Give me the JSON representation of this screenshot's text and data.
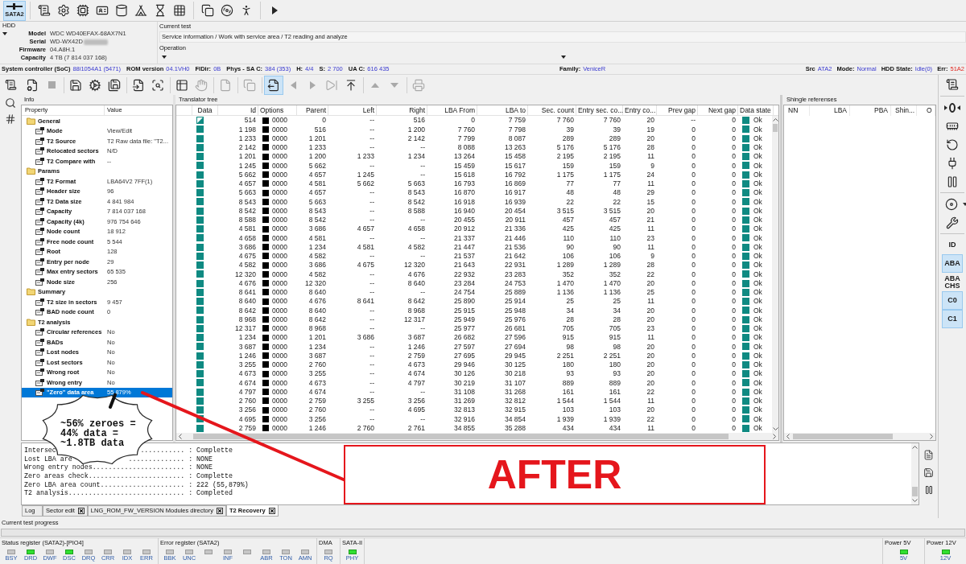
{
  "toolbar": {
    "items": [
      {
        "kind": "button",
        "label": "SATA2",
        "selected": true
      },
      {
        "kind": "separator"
      },
      {
        "kind": "button",
        "selected": false
      },
      {
        "kind": "button",
        "selected": false
      },
      {
        "kind": "button",
        "selected": false
      },
      {
        "kind": "button",
        "selected": false
      },
      {
        "kind": "button",
        "selected": false
      },
      {
        "kind": "button",
        "selected": false
      },
      {
        "kind": "button",
        "selected": false
      },
      {
        "kind": "button",
        "selected": false
      },
      {
        "kind": "separator"
      },
      {
        "kind": "button",
        "selected": false
      },
      {
        "kind": "button",
        "selected": false
      },
      {
        "kind": "button",
        "selected": false
      },
      {
        "kind": "separator"
      },
      {
        "kind": "button",
        "selected": false
      }
    ]
  },
  "hdd": {
    "title": "HDD",
    "fields": [
      {
        "label": "Model",
        "value": "WDC WD40EFAX-68AX7N1",
        "redacted": false
      },
      {
        "label": "Serial",
        "value": "WD-WX42D",
        "redacted": true
      },
      {
        "label": "Firmware",
        "value": "04.A8H.1",
        "redacted": false
      },
      {
        "label": "Capacity",
        "value": "4 TB (7 814 037 168)",
        "redacted": false
      }
    ]
  },
  "current_test": {
    "title": "Current test",
    "value": "Service information / Work with service area / T2 reading and analyze"
  },
  "operation": {
    "title": "Operation"
  },
  "status_line": {
    "left": [
      {
        "label": "System controller (SoC)",
        "value": "88i1054A1 (5471)",
        "alert": false
      },
      {
        "label": "ROM version",
        "value": "04.1VH0",
        "alert": false
      },
      {
        "label": "FIDir:",
        "value": "0B",
        "alert": false
      },
      {
        "label": "Phys - SA C:",
        "value": "384 (353)",
        "alert": false
      },
      {
        "label": "H:",
        "value": "4/4",
        "alert": false
      },
      {
        "label": "S:",
        "value": "2 700",
        "alert": false
      },
      {
        "label": "UA C:",
        "value": "616 435",
        "alert": false
      }
    ],
    "middle": [
      {
        "label": "Family:",
        "value": "VeniceR",
        "alert": false
      }
    ],
    "right": [
      {
        "label": "Src",
        "value": "ATA2",
        "alert": false
      },
      {
        "label": "Mode:",
        "value": "Normal",
        "alert": false
      },
      {
        "label": "HDD State:",
        "value": "Idle(0)",
        "alert": false
      },
      {
        "label": "Err:",
        "value": "51A2",
        "alert": true
      }
    ]
  },
  "toolbar2": {
    "items": [
      {
        "kind": "button",
        "disabled": false,
        "selected": false
      },
      {
        "kind": "button",
        "disabled": true,
        "selected": false
      },
      {
        "kind": "separator"
      },
      {
        "kind": "button",
        "disabled": false,
        "selected": false
      },
      {
        "kind": "button",
        "disabled": false,
        "selected": false
      },
      {
        "kind": "button",
        "disabled": false,
        "selected": false
      },
      {
        "kind": "separator"
      },
      {
        "kind": "button",
        "disabled": false,
        "selected": false
      },
      {
        "kind": "button",
        "disabled": false,
        "selected": false
      },
      {
        "kind": "separator"
      },
      {
        "kind": "button",
        "disabled": false,
        "selected": false
      },
      {
        "kind": "button",
        "disabled": true,
        "selected": false
      },
      {
        "kind": "separator"
      },
      {
        "kind": "button",
        "disabled": true,
        "selected": false
      },
      {
        "kind": "separator"
      },
      {
        "kind": "button",
        "disabled": true,
        "selected": false
      },
      {
        "kind": "separator"
      },
      {
        "kind": "button",
        "disabled": false,
        "selected": true
      },
      {
        "kind": "button",
        "disabled": true,
        "selected": false
      },
      {
        "kind": "button",
        "disabled": true,
        "selected": false
      },
      {
        "kind": "button",
        "disabled": true,
        "selected": false
      },
      {
        "kind": "button",
        "disabled": false,
        "selected": false
      },
      {
        "kind": "separator"
      },
      {
        "kind": "button",
        "disabled": true,
        "selected": false
      },
      {
        "kind": "button",
        "disabled": true,
        "selected": false
      },
      {
        "kind": "separator"
      },
      {
        "kind": "button",
        "disabled": true,
        "selected": false
      }
    ]
  },
  "right_toolbar": {
    "items": [
      {
        "kind": "button",
        "selected": false
      },
      {
        "kind": "separator"
      },
      {
        "kind": "button",
        "selected": false
      },
      {
        "kind": "button",
        "selected": false
      },
      {
        "kind": "button",
        "selected": false
      },
      {
        "kind": "button",
        "selected": false
      },
      {
        "kind": "button",
        "selected": false
      },
      {
        "kind": "separator"
      },
      {
        "kind": "dropdown",
        "selected": false
      },
      {
        "kind": "button",
        "selected": false
      },
      {
        "kind": "separator"
      },
      {
        "kind": "text",
        "label": "ID",
        "selected": false
      },
      {
        "kind": "text",
        "label": "ABA",
        "selected": true
      },
      {
        "kind": "text",
        "label": "ABA CHS",
        "selected": false
      },
      {
        "kind": "text",
        "label": "C0",
        "selected": true
      },
      {
        "kind": "text",
        "label": "C1",
        "selected": true
      }
    ]
  },
  "info": {
    "title": "Info",
    "columns": [
      "Property",
      "Value"
    ],
    "groups": [
      {
        "label": "General",
        "selected": false,
        "children": [
          {
            "label": "Mode",
            "value": "View/Edit",
            "selected": false
          },
          {
            "label": "T2 Source",
            "value": "T2 Raw data file: \"T2...",
            "selected": false
          },
          {
            "label": "Relocated sectors",
            "value": "N/D",
            "selected": false
          },
          {
            "label": "T2 Compare with",
            "value": "--",
            "selected": false
          }
        ]
      },
      {
        "label": "Params",
        "selected": false,
        "children": [
          {
            "label": "T2 Format",
            "value": "LBA64V2 7FF(1)",
            "selected": false
          },
          {
            "label": "Header size",
            "value": "96",
            "selected": false
          },
          {
            "label": "T2 Data size",
            "value": "4 841 984",
            "selected": false
          },
          {
            "label": "Capacity",
            "value": "7 814 037 168",
            "selected": false
          },
          {
            "label": "Capacity (4k)",
            "value": "976 754 646",
            "selected": false
          },
          {
            "label": "Node count",
            "value": "18 912",
            "selected": false
          },
          {
            "label": "Free node count",
            "value": "5 544",
            "selected": false
          },
          {
            "label": "Root",
            "value": "128",
            "selected": false
          },
          {
            "label": "Entry per node",
            "value": "29",
            "selected": false
          },
          {
            "label": "Max entry sectors",
            "value": "65 535",
            "selected": false
          },
          {
            "label": "Node size",
            "value": "256",
            "selected": false
          }
        ]
      },
      {
        "label": "Summary",
        "selected": false,
        "children": [
          {
            "label": "T2 size in sectors",
            "value": "9 457",
            "selected": false
          },
          {
            "label": "BAD node count",
            "value": "0",
            "selected": false
          }
        ]
      },
      {
        "label": "T2 analysis",
        "selected": false,
        "children": [
          {
            "label": "Circular references",
            "value": "No",
            "selected": false
          },
          {
            "label": "BADs",
            "value": "No",
            "selected": false
          },
          {
            "label": "Lost nodes",
            "value": "No",
            "selected": false
          },
          {
            "label": "Lost sectors",
            "value": "No",
            "selected": false
          },
          {
            "label": "Wrong root",
            "value": "No",
            "selected": false
          },
          {
            "label": "Wrong entry",
            "value": "No",
            "selected": false
          },
          {
            "label": "\"Zero\" data area",
            "value": "55,879%",
            "selected": true
          }
        ]
      }
    ]
  },
  "translator": {
    "title": "Translator tree",
    "columns": [
      "Data",
      "Id",
      "Options",
      "Parent",
      "Left",
      "Right",
      "LBA From",
      "LBA to",
      "Sec. count",
      "Entry sec. co...",
      "Entry co...",
      "Prev gap",
      "Next gap",
      "Data state"
    ],
    "rows": [
      {
        "partial": true,
        "cells": [
          "",
          "514",
          "0000",
          "0",
          "--",
          "516",
          "0",
          "7 759",
          "7 760",
          "7 760",
          "20",
          "--",
          "0",
          "Ok"
        ]
      },
      {
        "partial": false,
        "cells": [
          "",
          "1 198",
          "0000",
          "516",
          "--",
          "1 200",
          "7 760",
          "7 798",
          "39",
          "39",
          "19",
          "0",
          "0",
          "Ok"
        ]
      },
      {
        "partial": false,
        "cells": [
          "",
          "1 233",
          "0000",
          "1 201",
          "--",
          "2 142",
          "7 799",
          "8 087",
          "289",
          "289",
          "20",
          "0",
          "0",
          "Ok"
        ]
      },
      {
        "partial": false,
        "cells": [
          "",
          "2 142",
          "0000",
          "1 233",
          "--",
          "--",
          "8 088",
          "13 263",
          "5 176",
          "5 176",
          "28",
          "0",
          "0",
          "Ok"
        ]
      },
      {
        "partial": false,
        "cells": [
          "",
          "1 201",
          "0000",
          "1 200",
          "1 233",
          "1 234",
          "13 264",
          "15 458",
          "2 195",
          "2 195",
          "11",
          "0",
          "0",
          "Ok"
        ]
      },
      {
        "partial": false,
        "cells": [
          "",
          "1 245",
          "0000",
          "5 662",
          "--",
          "--",
          "15 459",
          "15 617",
          "159",
          "159",
          "9",
          "0",
          "0",
          "Ok"
        ]
      },
      {
        "partial": false,
        "cells": [
          "",
          "5 662",
          "0000",
          "4 657",
          "1 245",
          "--",
          "15 618",
          "16 792",
          "1 175",
          "1 175",
          "24",
          "0",
          "0",
          "Ok"
        ]
      },
      {
        "partial": false,
        "cells": [
          "",
          "4 657",
          "0000",
          "4 581",
          "5 662",
          "5 663",
          "16 793",
          "16 869",
          "77",
          "77",
          "11",
          "0",
          "0",
          "Ok"
        ]
      },
      {
        "partial": false,
        "cells": [
          "",
          "5 663",
          "0000",
          "4 657",
          "--",
          "8 543",
          "16 870",
          "16 917",
          "48",
          "48",
          "29",
          "0",
          "0",
          "Ok"
        ]
      },
      {
        "partial": false,
        "cells": [
          "",
          "8 543",
          "0000",
          "5 663",
          "--",
          "8 542",
          "16 918",
          "16 939",
          "22",
          "22",
          "15",
          "0",
          "0",
          "Ok"
        ]
      },
      {
        "partial": false,
        "cells": [
          "",
          "8 542",
          "0000",
          "8 543",
          "--",
          "8 588",
          "16 940",
          "20 454",
          "3 515",
          "3 515",
          "20",
          "0",
          "0",
          "Ok"
        ]
      },
      {
        "partial": false,
        "cells": [
          "",
          "8 588",
          "0000",
          "8 542",
          "--",
          "--",
          "20 455",
          "20 911",
          "457",
          "457",
          "21",
          "0",
          "0",
          "Ok"
        ]
      },
      {
        "partial": false,
        "cells": [
          "",
          "4 581",
          "0000",
          "3 686",
          "4 657",
          "4 658",
          "20 912",
          "21 336",
          "425",
          "425",
          "11",
          "0",
          "0",
          "Ok"
        ]
      },
      {
        "partial": false,
        "cells": [
          "",
          "4 658",
          "0000",
          "4 581",
          "--",
          "--",
          "21 337",
          "21 446",
          "110",
          "110",
          "23",
          "0",
          "0",
          "Ok"
        ]
      },
      {
        "partial": false,
        "cells": [
          "",
          "3 686",
          "0000",
          "1 234",
          "4 581",
          "4 582",
          "21 447",
          "21 536",
          "90",
          "90",
          "11",
          "0",
          "0",
          "Ok"
        ]
      },
      {
        "partial": false,
        "cells": [
          "",
          "4 675",
          "0000",
          "4 582",
          "--",
          "--",
          "21 537",
          "21 642",
          "106",
          "106",
          "9",
          "0",
          "0",
          "Ok"
        ]
      },
      {
        "partial": false,
        "cells": [
          "",
          "4 582",
          "0000",
          "3 686",
          "4 675",
          "12 320",
          "21 643",
          "22 931",
          "1 289",
          "1 289",
          "28",
          "0",
          "0",
          "Ok"
        ]
      },
      {
        "partial": false,
        "cells": [
          "",
          "12 320",
          "0000",
          "4 582",
          "--",
          "4 676",
          "22 932",
          "23 283",
          "352",
          "352",
          "22",
          "0",
          "0",
          "Ok"
        ]
      },
      {
        "partial": false,
        "cells": [
          "",
          "4 676",
          "0000",
          "12 320",
          "--",
          "8 640",
          "23 284",
          "24 753",
          "1 470",
          "1 470",
          "20",
          "0",
          "0",
          "Ok"
        ]
      },
      {
        "partial": false,
        "cells": [
          "",
          "8 641",
          "0000",
          "8 640",
          "--",
          "--",
          "24 754",
          "25 889",
          "1 136",
          "1 136",
          "25",
          "0",
          "0",
          "Ok"
        ]
      },
      {
        "partial": false,
        "cells": [
          "",
          "8 640",
          "0000",
          "4 676",
          "8 641",
          "8 642",
          "25 890",
          "25 914",
          "25",
          "25",
          "11",
          "0",
          "0",
          "Ok"
        ]
      },
      {
        "partial": false,
        "cells": [
          "",
          "8 642",
          "0000",
          "8 640",
          "--",
          "8 968",
          "25 915",
          "25 948",
          "34",
          "34",
          "20",
          "0",
          "0",
          "Ok"
        ]
      },
      {
        "partial": false,
        "cells": [
          "",
          "8 968",
          "0000",
          "8 642",
          "--",
          "12 317",
          "25 949",
          "25 976",
          "28",
          "28",
          "20",
          "0",
          "0",
          "Ok"
        ]
      },
      {
        "partial": false,
        "cells": [
          "",
          "12 317",
          "0000",
          "8 968",
          "--",
          "--",
          "25 977",
          "26 681",
          "705",
          "705",
          "23",
          "0",
          "0",
          "Ok"
        ]
      },
      {
        "partial": false,
        "cells": [
          "",
          "1 234",
          "0000",
          "1 201",
          "3 686",
          "3 687",
          "26 682",
          "27 596",
          "915",
          "915",
          "11",
          "0",
          "0",
          "Ok"
        ]
      },
      {
        "partial": false,
        "cells": [
          "",
          "3 687",
          "0000",
          "1 234",
          "--",
          "1 246",
          "27 597",
          "27 694",
          "98",
          "98",
          "20",
          "0",
          "0",
          "Ok"
        ]
      },
      {
        "partial": false,
        "cells": [
          "",
          "1 246",
          "0000",
          "3 687",
          "--",
          "2 759",
          "27 695",
          "29 945",
          "2 251",
          "2 251",
          "20",
          "0",
          "0",
          "Ok"
        ]
      },
      {
        "partial": false,
        "cells": [
          "",
          "3 255",
          "0000",
          "2 760",
          "--",
          "4 673",
          "29 946",
          "30 125",
          "180",
          "180",
          "20",
          "0",
          "0",
          "Ok"
        ]
      },
      {
        "partial": false,
        "cells": [
          "",
          "4 673",
          "0000",
          "3 255",
          "--",
          "4 674",
          "30 126",
          "30 218",
          "93",
          "93",
          "20",
          "0",
          "0",
          "Ok"
        ]
      },
      {
        "partial": false,
        "cells": [
          "",
          "4 674",
          "0000",
          "4 673",
          "--",
          "4 797",
          "30 219",
          "31 107",
          "889",
          "889",
          "20",
          "0",
          "0",
          "Ok"
        ]
      },
      {
        "partial": false,
        "cells": [
          "",
          "4 797",
          "0000",
          "4 674",
          "--",
          "--",
          "31 108",
          "31 268",
          "161",
          "161",
          "22",
          "0",
          "0",
          "Ok"
        ]
      },
      {
        "partial": false,
        "cells": [
          "",
          "2 760",
          "0000",
          "2 759",
          "3 255",
          "3 256",
          "31 269",
          "32 812",
          "1 544",
          "1 544",
          "11",
          "0",
          "0",
          "Ok"
        ]
      },
      {
        "partial": false,
        "cells": [
          "",
          "3 256",
          "0000",
          "2 760",
          "--",
          "4 695",
          "32 813",
          "32 915",
          "103",
          "103",
          "20",
          "0",
          "0",
          "Ok"
        ]
      },
      {
        "partial": false,
        "cells": [
          "",
          "4 695",
          "0000",
          "3 256",
          "--",
          "--",
          "32 916",
          "34 854",
          "1 939",
          "1 939",
          "22",
          "0",
          "0",
          "Ok"
        ]
      },
      {
        "partial": false,
        "cells": [
          "",
          "2 759",
          "0000",
          "1 246",
          "2 760",
          "2 761",
          "34 855",
          "35 288",
          "434",
          "434",
          "11",
          "0",
          "0",
          "Ok"
        ]
      }
    ]
  },
  "shingle": {
    "title": "Shingle referenses",
    "columns": [
      "NN",
      "LBA",
      "PBA",
      "Shin...",
      "O"
    ]
  },
  "log": {
    "lines": [
      {
        "parts": [
          "Intersec",
          "..........."
        ],
        "value": ": Complette"
      },
      {
        "parts": [
          "Lost LBA are",
          ".............."
        ],
        "value": ": NONE"
      },
      {
        "parts": [
          "Wrong entry nodes......................."
        ],
        "value": ": NONE"
      },
      {
        "parts": [
          "Zero areas check........................"
        ],
        "value": ": Complette"
      },
      {
        "parts": [
          "Zero LBA area count....................."
        ],
        "value": ": 222 (55,879%)"
      },
      {
        "parts": [
          "T2 analysis............................."
        ],
        "value": ": Completed"
      }
    ]
  },
  "tabs": [
    {
      "label": "Log",
      "closable": false,
      "selected": false
    },
    {
      "label": "Sector edit",
      "closable": true,
      "selected": false
    },
    {
      "label": "LNG_ROM_FW_VERSION Modules directory",
      "closable": true,
      "selected": false
    },
    {
      "label": "T2 Recovery",
      "closable": true,
      "selected": true
    }
  ],
  "progress": {
    "label": "Current test progress"
  },
  "registers": [
    {
      "title": "Status register (SATA2)-[PIO4]",
      "leds": [
        {
          "label": "BSY",
          "on": false
        },
        {
          "label": "DRD",
          "on": true
        },
        {
          "label": "DWF",
          "on": false
        },
        {
          "label": "DSC",
          "on": true
        },
        {
          "label": "DRQ",
          "on": false
        },
        {
          "label": "CRR",
          "on": false
        },
        {
          "label": "IDX",
          "on": false
        },
        {
          "label": "ERR",
          "on": false
        }
      ]
    },
    {
      "title": "Error register (SATA2)",
      "leds": [
        {
          "label": "BBK",
          "on": false
        },
        {
          "label": "UNC",
          "on": false
        },
        {
          "on": false
        },
        {
          "label": "INF",
          "on": false
        },
        {
          "on": false
        },
        {
          "label": "ABR",
          "on": false
        },
        {
          "label": "TON",
          "on": false
        },
        {
          "label": "AMN",
          "on": false
        }
      ]
    },
    {
      "title": "DMA",
      "leds": [
        {
          "label": "RQ",
          "on": false
        }
      ]
    },
    {
      "title": "SATA-II",
      "leds": [
        {
          "label": "PHY",
          "on": true
        }
      ]
    }
  ],
  "power": [
    {
      "title": "Power 5V",
      "leds": [
        {
          "label": "5V",
          "on": true
        }
      ]
    },
    {
      "title": "Power 12V",
      "leds": [
        {
          "label": "12V",
          "on": true
        }
      ]
    }
  ],
  "annotations": {
    "callout": [
      "~56% zeroes =",
      "44% data =",
      "~1.8TB data"
    ],
    "stamp": "AFTER"
  }
}
